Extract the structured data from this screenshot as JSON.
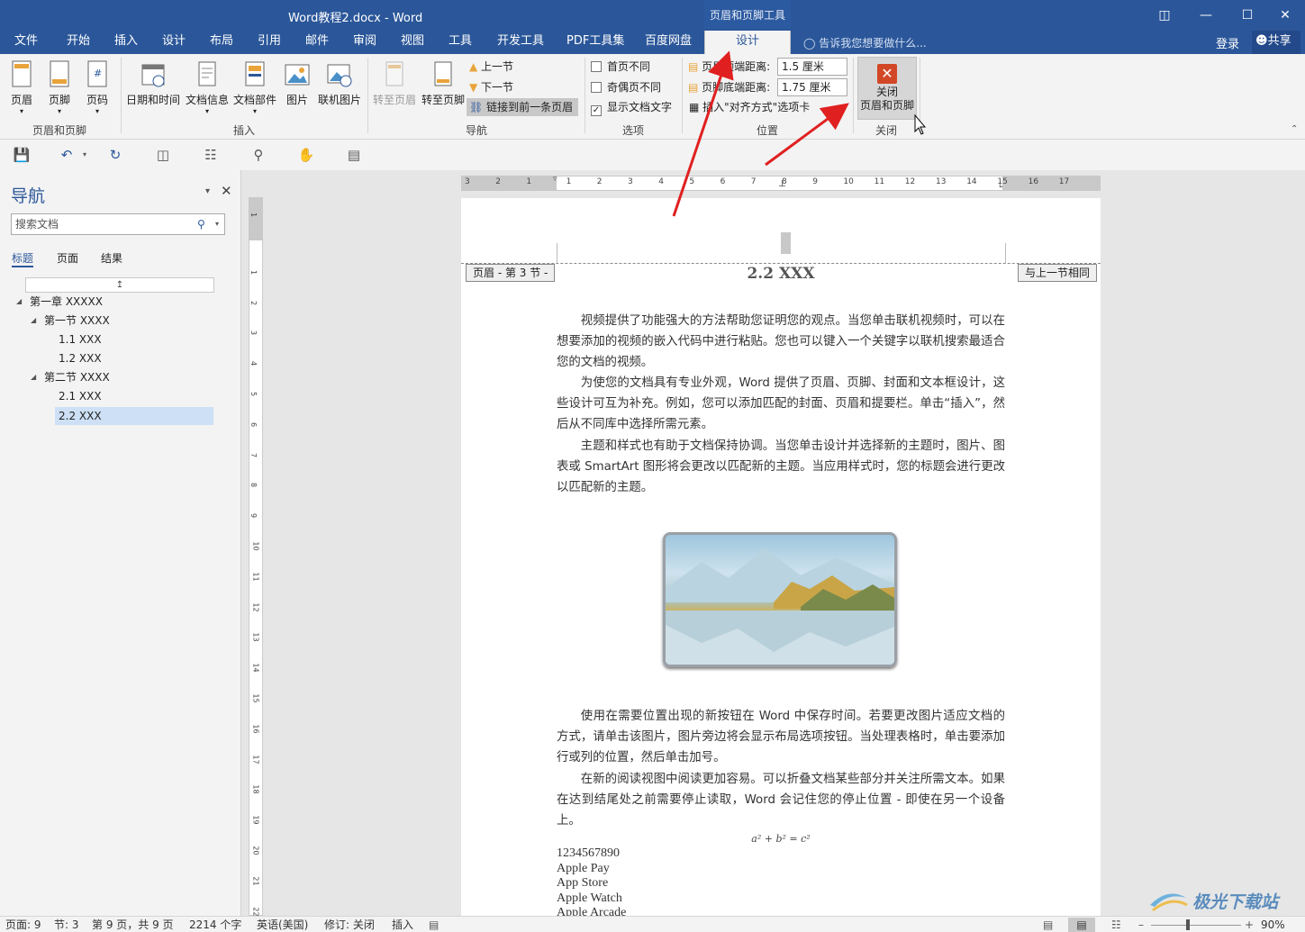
{
  "window": {
    "title": "Word教程2.docx - Word",
    "context_tool": "页眉和页脚工具",
    "buttons": [
      "restore-ribbon",
      "minimize",
      "maximize",
      "close"
    ]
  },
  "menu": {
    "tabs": [
      "文件",
      "开始",
      "插入",
      "设计",
      "布局",
      "引用",
      "邮件",
      "审阅",
      "视图",
      "工具",
      "开发工具",
      "PDF工具集",
      "百度网盘",
      "设计"
    ],
    "active_tab": "设计",
    "tell_me": "告诉我您想要做什么...",
    "login": "登录",
    "share": "共享"
  },
  "ribbon": {
    "group1": {
      "label": "页眉和页脚",
      "buttons": [
        "页眉",
        "页脚",
        "页码"
      ]
    },
    "group2": {
      "label": "插入",
      "buttons": [
        "日期和时间",
        "文档信息",
        "文档部件",
        "图片",
        "联机图片"
      ]
    },
    "group3": {
      "label": "导航",
      "buttons": [
        "转至页眉",
        "转至页脚"
      ],
      "prev": "上一节",
      "next": "下一节",
      "link": "链接到前一条页眉"
    },
    "group4": {
      "label": "选项",
      "opt1": "首页不同",
      "opt2": "奇偶页不同",
      "opt3": "显示文档文字",
      "opt3_checked": true
    },
    "group5": {
      "label": "位置",
      "header_dist_label": "页眉顶端距离:",
      "header_dist": "1.5 厘米",
      "footer_dist_label": "页脚底端距离:",
      "footer_dist": "1.75 厘米",
      "insert_tab": "插入\"对齐方式\"选项卡"
    },
    "group6": {
      "label": "关闭",
      "close_line1": "关闭",
      "close_line2": "页眉和页脚"
    }
  },
  "nav": {
    "title": "导航",
    "search_placeholder": "搜索文档",
    "tabs": [
      "标题",
      "页面",
      "结果"
    ],
    "tree": [
      {
        "label": "第一章 XXXXX",
        "level": 0
      },
      {
        "label": "第一节 XXXX",
        "level": 1
      },
      {
        "label": "1.1 XXX",
        "level": 2
      },
      {
        "label": "1.2 XXX",
        "level": 2
      },
      {
        "label": "第二节 XXXX",
        "level": 1
      },
      {
        "label": "2.1 XXX",
        "level": 2
      },
      {
        "label": "2.2 XXX",
        "level": 2
      }
    ],
    "selected": "2.2 XXX"
  },
  "document": {
    "header_section_tag": "页眉 - 第 3 节 -",
    "header_same_tag": "与上一节相同",
    "header_title": "2.2 XXX",
    "paragraphs_top": [
      "视频提供了功能强大的方法帮助您证明您的观点。当您单击联机视频时，可以在想要添加的视频的嵌入代码中进行粘贴。您也可以键入一个关键字以联机搜索最适合您的文档的视频。",
      "为使您的文档具有专业外观，Word 提供了页眉、页脚、封面和文本框设计，这些设计可互为补充。例如，您可以添加匹配的封面、页眉和提要栏。单击“插入”，然后从不同库中选择所需元素。",
      "主题和样式也有助于文档保持协调。当您单击设计并选择新的主题时，图片、图表或 SmartArt 图形将会更改以匹配新的主题。当应用样式时，您的标题会进行更改以匹配新的主题。"
    ],
    "paragraphs_bottom": [
      "使用在需要位置出现的新按钮在 Word 中保存时间。若要更改图片适应文档的方式，请单击该图片，图片旁边将会显示布局选项按钮。当处理表格时，单击要添加行或列的位置，然后单击加号。",
      "在新的阅读视图中阅读更加容易。可以折叠文档某些部分并关注所需文本。如果在达到结尾处之前需要停止读取，Word 会记住您的停止位置 - 即使在另一个设备上。"
    ],
    "equation": "a² + b² = c²",
    "list": [
      "1234567890",
      "Apple Pay",
      "App Store",
      "Apple Watch",
      "Apple Arcade"
    ]
  },
  "ruler": {
    "h_ticks": [
      "3",
      "2",
      "1",
      "1",
      "2",
      "3",
      "4",
      "5",
      "6",
      "7",
      "8",
      "9",
      "10",
      "11",
      "12",
      "13",
      "14",
      "15",
      "16",
      "17"
    ],
    "v_ticks": [
      "1",
      "1",
      "2",
      "3",
      "4",
      "5",
      "6",
      "7",
      "8",
      "9",
      "10",
      "11",
      "12",
      "13",
      "14",
      "15",
      "16",
      "17",
      "18",
      "19",
      "20",
      "21",
      "22"
    ]
  },
  "status": {
    "page": "页面: 9",
    "section": "节: 3",
    "page_of": "第 9 页，共 9 页",
    "words": "2214 个字",
    "lang": "英语(美国)",
    "track": "修订: 关闭",
    "mode": "插入",
    "zoom": "90%"
  },
  "watermark": "极光下载站"
}
